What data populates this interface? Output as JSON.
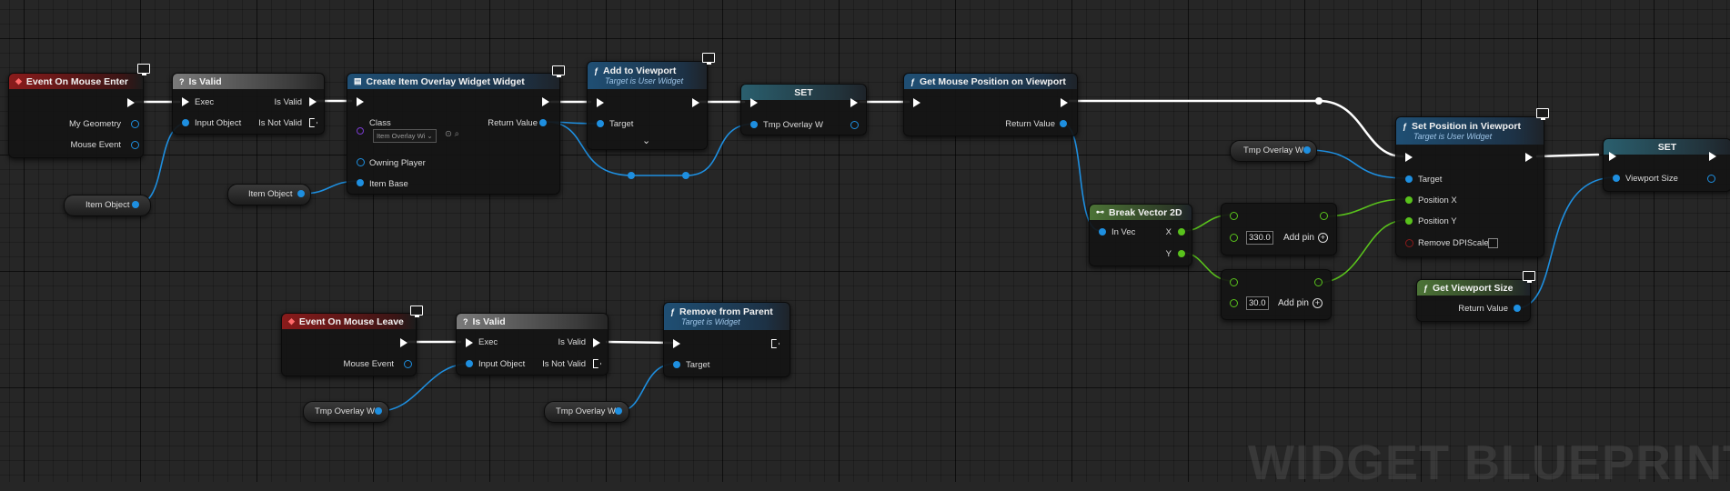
{
  "watermark": "WIDGET BLUEPRINT",
  "colors": {
    "exec": "#ffffff",
    "object": "#1e8fe0",
    "float": "#59c21c",
    "event_header": "#8a1b1b",
    "func_header": "#1f4f74",
    "vector2d": "#59c21c"
  },
  "nodes": {
    "event_enter": {
      "title": "Event On Mouse Enter",
      "pins": [
        "My Geometry",
        "Mouse Event"
      ]
    },
    "isvalid1": {
      "title": "Is Valid",
      "pins": [
        "Exec",
        "Input Object",
        "Is Valid",
        "Is Not Valid"
      ]
    },
    "create_widget": {
      "title": "Create Item Overlay Widget Widget",
      "class_label": "Class",
      "class_value": "Item Overlay Wi",
      "return_label": "Return Value",
      "owning_player": "Owning Player",
      "item_base": "Item Base"
    },
    "add_viewport": {
      "title": "Add to Viewport",
      "subtitle": "Target is User Widget",
      "target": "Target"
    },
    "set1": {
      "title": "SET",
      "pin": "Tmp Overlay W"
    },
    "get_mouse": {
      "title": "Get Mouse Position on Viewport",
      "return_label": "Return Value"
    },
    "break_vec": {
      "title": "Break Vector 2D",
      "in": "In Vec",
      "x": "X",
      "y": "Y"
    },
    "add1": {
      "value": "330.0",
      "add_pin": "Add pin"
    },
    "add2": {
      "value": "30.0",
      "add_pin": "Add pin"
    },
    "set_pos": {
      "title": "Set Position in Viewport",
      "subtitle": "Target is User Widget",
      "pins": [
        "Target",
        "Position X",
        "Position Y",
        "Remove DPIScale"
      ]
    },
    "set2": {
      "title": "SET",
      "pin": "Viewport Size"
    },
    "get_vp": {
      "title": "Get Viewport Size",
      "return_label": "Return Value"
    },
    "event_leave": {
      "title": "Event On Mouse Leave",
      "pin": "Mouse Event"
    },
    "isvalid2": {
      "title": "Is Valid",
      "pins": [
        "Exec",
        "Input Object",
        "Is Valid",
        "Is Not Valid"
      ]
    },
    "remove_parent": {
      "title": "Remove from Parent",
      "subtitle": "Target is Widget",
      "target": "Target"
    }
  },
  "variables": {
    "item_object_1": "Item Object",
    "item_object_2": "Item Object",
    "tmp_overlay_1": "Tmp Overlay W",
    "tmp_overlay_2": "Tmp Overlay W",
    "tmp_overlay_3": "Tmp Overlay W"
  }
}
